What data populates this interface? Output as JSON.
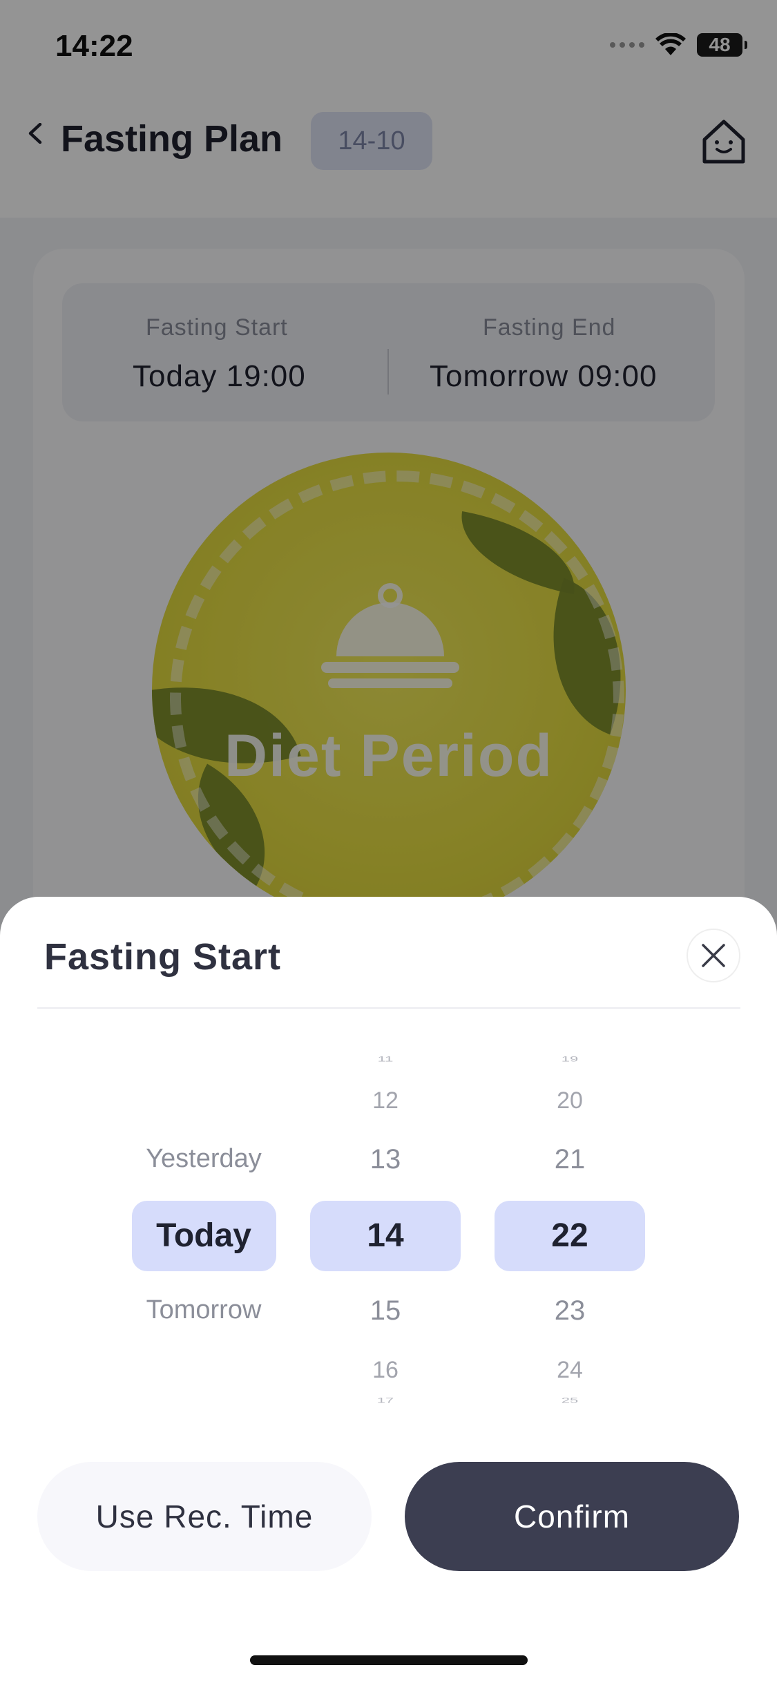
{
  "status": {
    "time": "14:22",
    "battery": "48"
  },
  "header": {
    "title": "Fasting Plan",
    "plan_badge": "14-10"
  },
  "summary": {
    "start_label": "Fasting Start",
    "start_value": "Today 19:00",
    "end_label": "Fasting End",
    "end_value": "Tomorrow 09:00"
  },
  "phase": {
    "label": "Diet Period"
  },
  "sheet": {
    "title": "Fasting Start",
    "day_column": {
      "options": [
        "Yesterday",
        "Today",
        "Tomorrow"
      ],
      "selected": "Today"
    },
    "hour_column": {
      "options": [
        "11",
        "12",
        "13",
        "14",
        "15",
        "16",
        "17"
      ],
      "selected": "14"
    },
    "minute_column": {
      "options": [
        "19",
        "20",
        "21",
        "22",
        "23",
        "24",
        "25"
      ],
      "selected": "22"
    },
    "rec_button": "Use Rec. Time",
    "confirm_button": "Confirm"
  },
  "colors": {
    "accent_highlight": "#d6dcfb",
    "confirm_bg": "#3c3e51",
    "diet_circle": "#e7df42"
  }
}
